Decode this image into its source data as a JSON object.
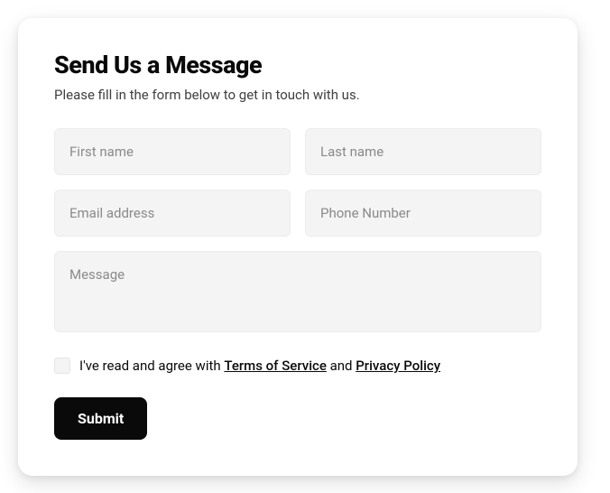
{
  "form": {
    "heading": "Send Us a Message",
    "subheading": "Please fill in the form below to get in touch with us.",
    "fields": {
      "first_name": {
        "placeholder": "First name",
        "value": ""
      },
      "last_name": {
        "placeholder": "Last name",
        "value": ""
      },
      "email": {
        "placeholder": "Email address",
        "value": ""
      },
      "phone": {
        "placeholder": "Phone Number",
        "value": ""
      },
      "message": {
        "placeholder": "Message",
        "value": ""
      }
    },
    "consent": {
      "checked": false,
      "prefix": "I've read and agree with ",
      "tos_label": "Terms of Service",
      "middle": " and ",
      "privacy_label": "Privacy Policy"
    },
    "submit_label": "Submit"
  }
}
